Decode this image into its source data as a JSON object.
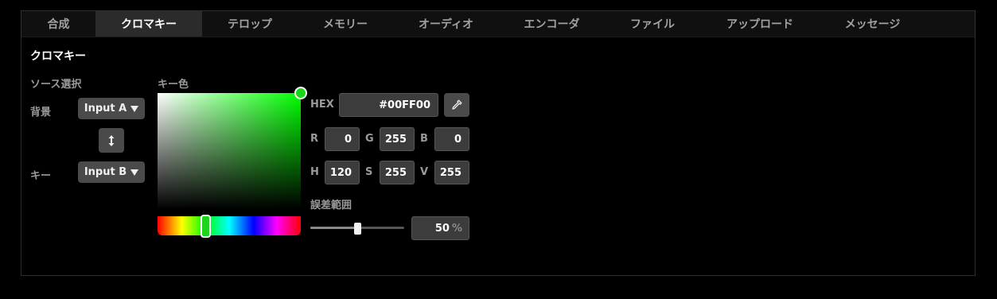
{
  "tabs": [
    {
      "label": "合成"
    },
    {
      "label": "クロマキー",
      "active": true
    },
    {
      "label": "テロップ"
    },
    {
      "label": "メモリー"
    },
    {
      "label": "オーディオ"
    },
    {
      "label": "エンコーダ"
    },
    {
      "label": "ファイル"
    },
    {
      "label": "アップロード"
    },
    {
      "label": "メッセージ"
    }
  ],
  "section": {
    "title": "クロマキー"
  },
  "source": {
    "heading": "ソース選択",
    "background_label": "背景",
    "background_value": "Input A",
    "swap_icon": "swap-vertical-icon",
    "key_label": "キー",
    "key_value": "Input B"
  },
  "key_color": {
    "heading": "キー色",
    "hue_deg": 120,
    "hex_label": "HEX",
    "hex_value": "#00FF00",
    "eyedropper_icon": "eyedropper-icon",
    "r_label": "R",
    "r_value": "0",
    "g_label": "G",
    "g_value": "255",
    "b_label": "B",
    "b_value": "0",
    "h_label": "H",
    "h_value": "120",
    "s_label": "S",
    "s_value": "255",
    "v_label": "V",
    "v_value": "255"
  },
  "tolerance": {
    "heading": "誤差範囲",
    "value": "50",
    "unit": "%",
    "level": 0.5
  },
  "colors": {
    "background": "#000000",
    "tab_active": "#2b2b2b",
    "key": "#00ff00"
  }
}
